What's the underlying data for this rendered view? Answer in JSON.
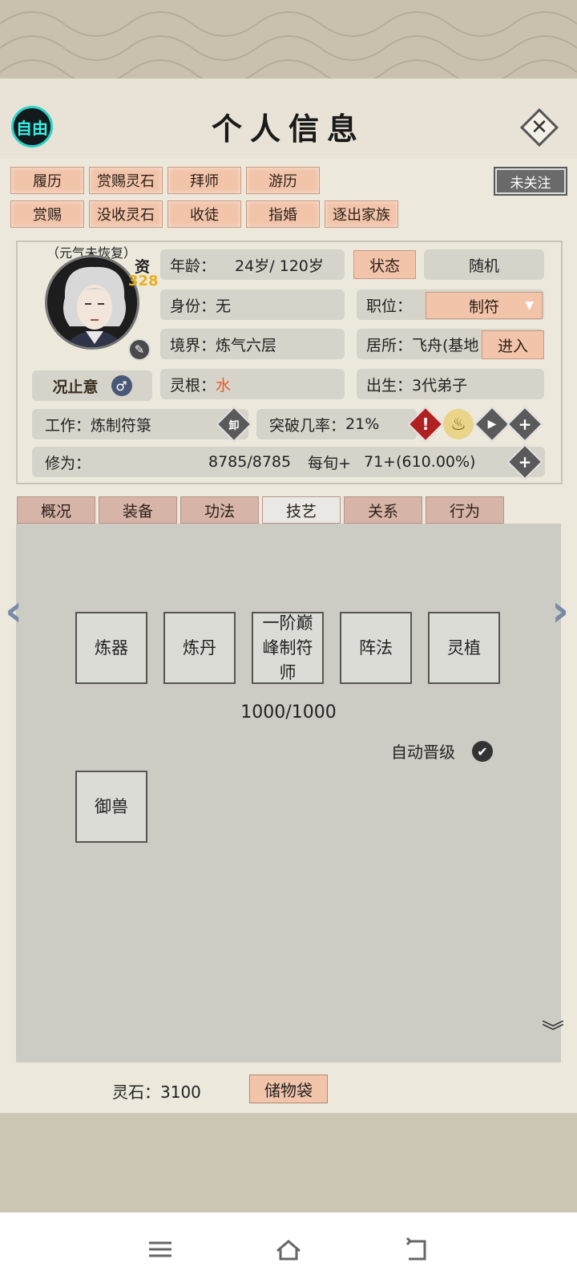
{
  "header": {
    "free_badge": "自由",
    "title": "个人信息",
    "close_icon": "close-icon"
  },
  "actions": {
    "row1": [
      "履历",
      "赏赐灵石",
      "拜师",
      "游历"
    ],
    "row2": [
      "赏赐",
      "没收灵石",
      "收徒",
      "指婚",
      "逐出家族"
    ],
    "follow": "未关注"
  },
  "profile": {
    "status_note": "（元气未恢复）",
    "aptitude_label": "资",
    "aptitude_value": "328",
    "name": "况止意",
    "gender_icon": "male-icon",
    "age_label": "年龄：",
    "age_value": "24岁/ 120岁",
    "state_button": "状态",
    "random_button": "随机",
    "identity_label": "身份：",
    "identity_value": "无",
    "position_label": "职位：",
    "position_value": "制符",
    "realm_label": "境界：",
    "realm_value": "炼气六层",
    "residence_label": "居所：",
    "residence_value": "飞舟(基地",
    "enter_button": "进入",
    "root_label": "灵根：",
    "root_value": "水",
    "birth_label": "出生：",
    "birth_value": "3代弟子",
    "work_label": "工作：",
    "work_value": "炼制符箓",
    "unload_button": "卸",
    "breakthrough_label": "突破几率：",
    "breakthrough_value": "21%",
    "cultivation_label": "修为：",
    "cultivation_value": "8785/8785",
    "per_period_label": "每旬+",
    "per_period_value": "71+(610.00%)"
  },
  "tabs": [
    "概况",
    "装备",
    "功法",
    "技艺",
    "关系",
    "行为"
  ],
  "active_tab": "技艺",
  "skills": {
    "row1": [
      "炼器",
      "炼丹",
      "一阶巅峰制符师",
      "阵法",
      "灵植"
    ],
    "row2": [
      "御兽"
    ],
    "progress": "1000/1000",
    "auto_upgrade": "自动晋级",
    "auto_upgrade_checked": true
  },
  "footer": {
    "spirit_stones_label": "灵石：",
    "spirit_stones_value": "3100",
    "bag_button": "储物袋"
  },
  "colors": {
    "accent_button": "#f2c4aa",
    "tab": "#d6b4a8",
    "water_root": "#e85a2a",
    "badge_ring": "#2bd3c9"
  }
}
